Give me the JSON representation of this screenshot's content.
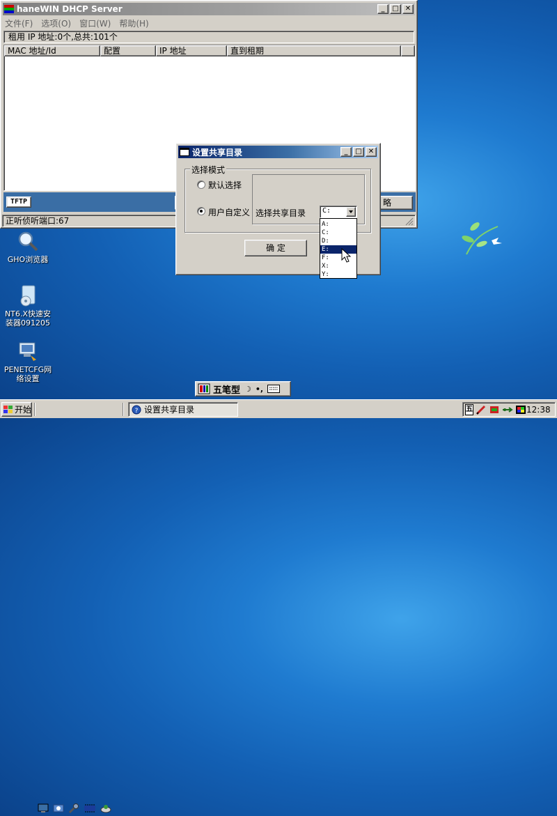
{
  "main_window": {
    "title": "haneWIN DHCP Server",
    "menu": [
      {
        "label": "文件(F)"
      },
      {
        "label": "选项(O)"
      },
      {
        "label": "窗口(W)"
      },
      {
        "label": "帮助(H)"
      }
    ],
    "info_bar": "租用 IP 地址:0个,总共:101个",
    "columns": [
      "MAC 地址/Id",
      "配置",
      "IP 地址",
      "直到租期"
    ],
    "tftp_label": "TFTP",
    "right_button_partial": "略",
    "status": "正听侦听端口:67"
  },
  "dialog": {
    "title": "设置共享目录",
    "group_label": "选择模式",
    "radio_default": "默认选择",
    "radio_custom": "用户自定义",
    "share_dir_label": "选择共享目录",
    "selected_drive": "C:",
    "drive_options": [
      "A:",
      "C:",
      "D:",
      "E:",
      "F:",
      "X:",
      "Y:"
    ],
    "highlighted_drive": "E:",
    "ok_button": "确 定"
  },
  "desktop_icons": [
    {
      "label": "GHO浏览器",
      "icon": "magnifier-icon"
    },
    {
      "label": "NT6.X快速安装器091205",
      "icon": "installer-icon"
    },
    {
      "label": "PENETCFG网络设置",
      "icon": "network-config-icon"
    }
  ],
  "ime_bar": {
    "mode": "五笔型"
  },
  "taskbar": {
    "start_label": "开始",
    "task_label": "设置共享目录",
    "ime_indicator": "五",
    "clock": "12:38"
  },
  "colors": {
    "title_active_start": "#0a246a",
    "title_active_end": "#a6caf0",
    "tftp_bar": "#3a6ea5",
    "highlight": "#0a246a"
  }
}
